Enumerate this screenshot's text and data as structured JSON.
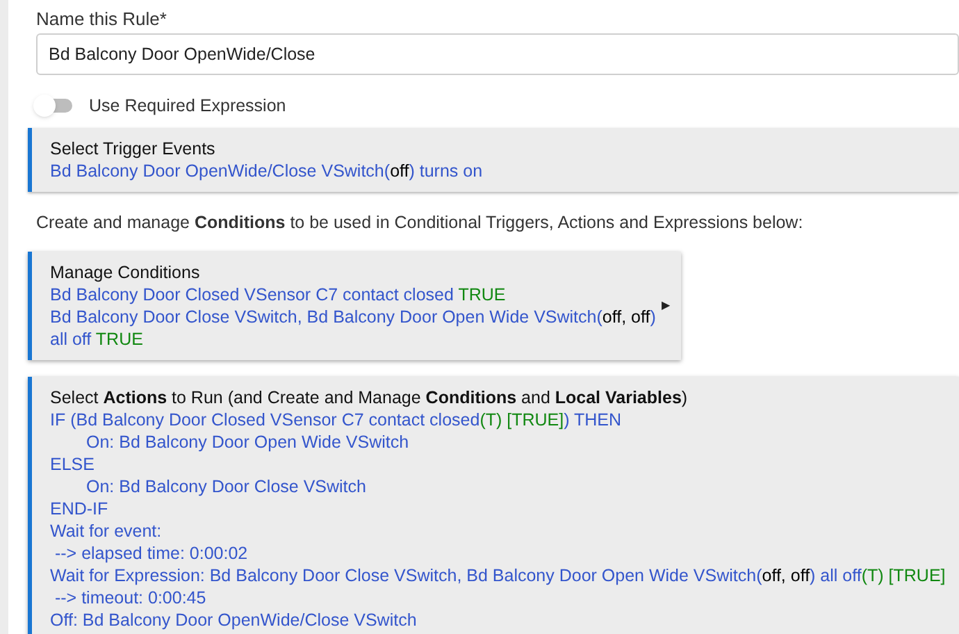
{
  "name_field": {
    "label": "Name this Rule*",
    "value": "Bd Balcony Door OpenWide/Close"
  },
  "toggle": {
    "label": "Use Required Expression",
    "on": false
  },
  "trigger_card": {
    "title": "Select Trigger Events",
    "lines": [
      [
        {
          "kind": "device",
          "text": "Bd Balcony Door OpenWide/Close VSwitch("
        },
        {
          "kind": "state",
          "text": "off"
        },
        {
          "kind": "device",
          "text": ") turns on"
        }
      ]
    ]
  },
  "conditions_intro": "Create and manage **Conditions** to be used in Conditional Triggers, Actions and Expressions below:",
  "conditions_card": {
    "title": "Manage Conditions",
    "expander": "▶",
    "lines": [
      [
        {
          "kind": "device",
          "text": "Bd Balcony Door Closed VSensor C7 contact closed "
        },
        {
          "kind": "result",
          "text": "TRUE"
        }
      ],
      [
        {
          "kind": "device",
          "text": "Bd Balcony Door Close VSwitch, Bd Balcony Door Open Wide VSwitch("
        },
        {
          "kind": "state",
          "text": "off, off"
        },
        {
          "kind": "device",
          "text": ")"
        }
      ],
      [
        {
          "kind": "device",
          "text": "all off "
        },
        {
          "kind": "result",
          "text": "TRUE"
        }
      ]
    ]
  },
  "actions_card": {
    "title": "Select **Actions** to Run (and Create and Manage **Conditions** and **Local Variables**)",
    "lines": [
      {
        "segments": [
          {
            "kind": "device",
            "text": "IF (Bd Balcony Door Closed VSensor C7 contact closed"
          },
          {
            "kind": "result",
            "text": "(T) [TRUE]"
          },
          {
            "kind": "device",
            "text": ") THEN"
          }
        ],
        "children": [
          {
            "segments": [
              {
                "kind": "device",
                "text": "On: Bd Balcony Door Open Wide VSwitch"
              }
            ]
          }
        ]
      },
      {
        "segments": [
          {
            "kind": "device",
            "text": "ELSE"
          }
        ],
        "children": [
          {
            "segments": [
              {
                "kind": "device",
                "text": "On: Bd Balcony Door Close VSwitch"
              }
            ]
          }
        ]
      },
      {
        "segments": [
          {
            "kind": "device",
            "text": "END-IF"
          }
        ]
      },
      {
        "segments": [
          {
            "kind": "device",
            "text": "Wait for event:"
          }
        ]
      },
      {
        "segments": [
          {
            "kind": "device",
            "text": " --> elapsed time: 0:00:02"
          }
        ]
      },
      {
        "segments": [
          {
            "kind": "device",
            "text": "Wait for Expression: Bd Balcony Door Close VSwitch, Bd Balcony Door Open Wide VSwitch("
          },
          {
            "kind": "state",
            "text": "off, off"
          },
          {
            "kind": "device",
            "text": ") all off"
          },
          {
            "kind": "result",
            "text": "(T) [TRUE]"
          }
        ]
      },
      {
        "segments": [
          {
            "kind": "device",
            "text": " --> timeout: 0:00:45"
          }
        ]
      },
      {
        "segments": [
          {
            "kind": "device",
            "text": "Off: Bd Balcony Door OpenWide/Close VSwitch"
          }
        ]
      }
    ]
  }
}
